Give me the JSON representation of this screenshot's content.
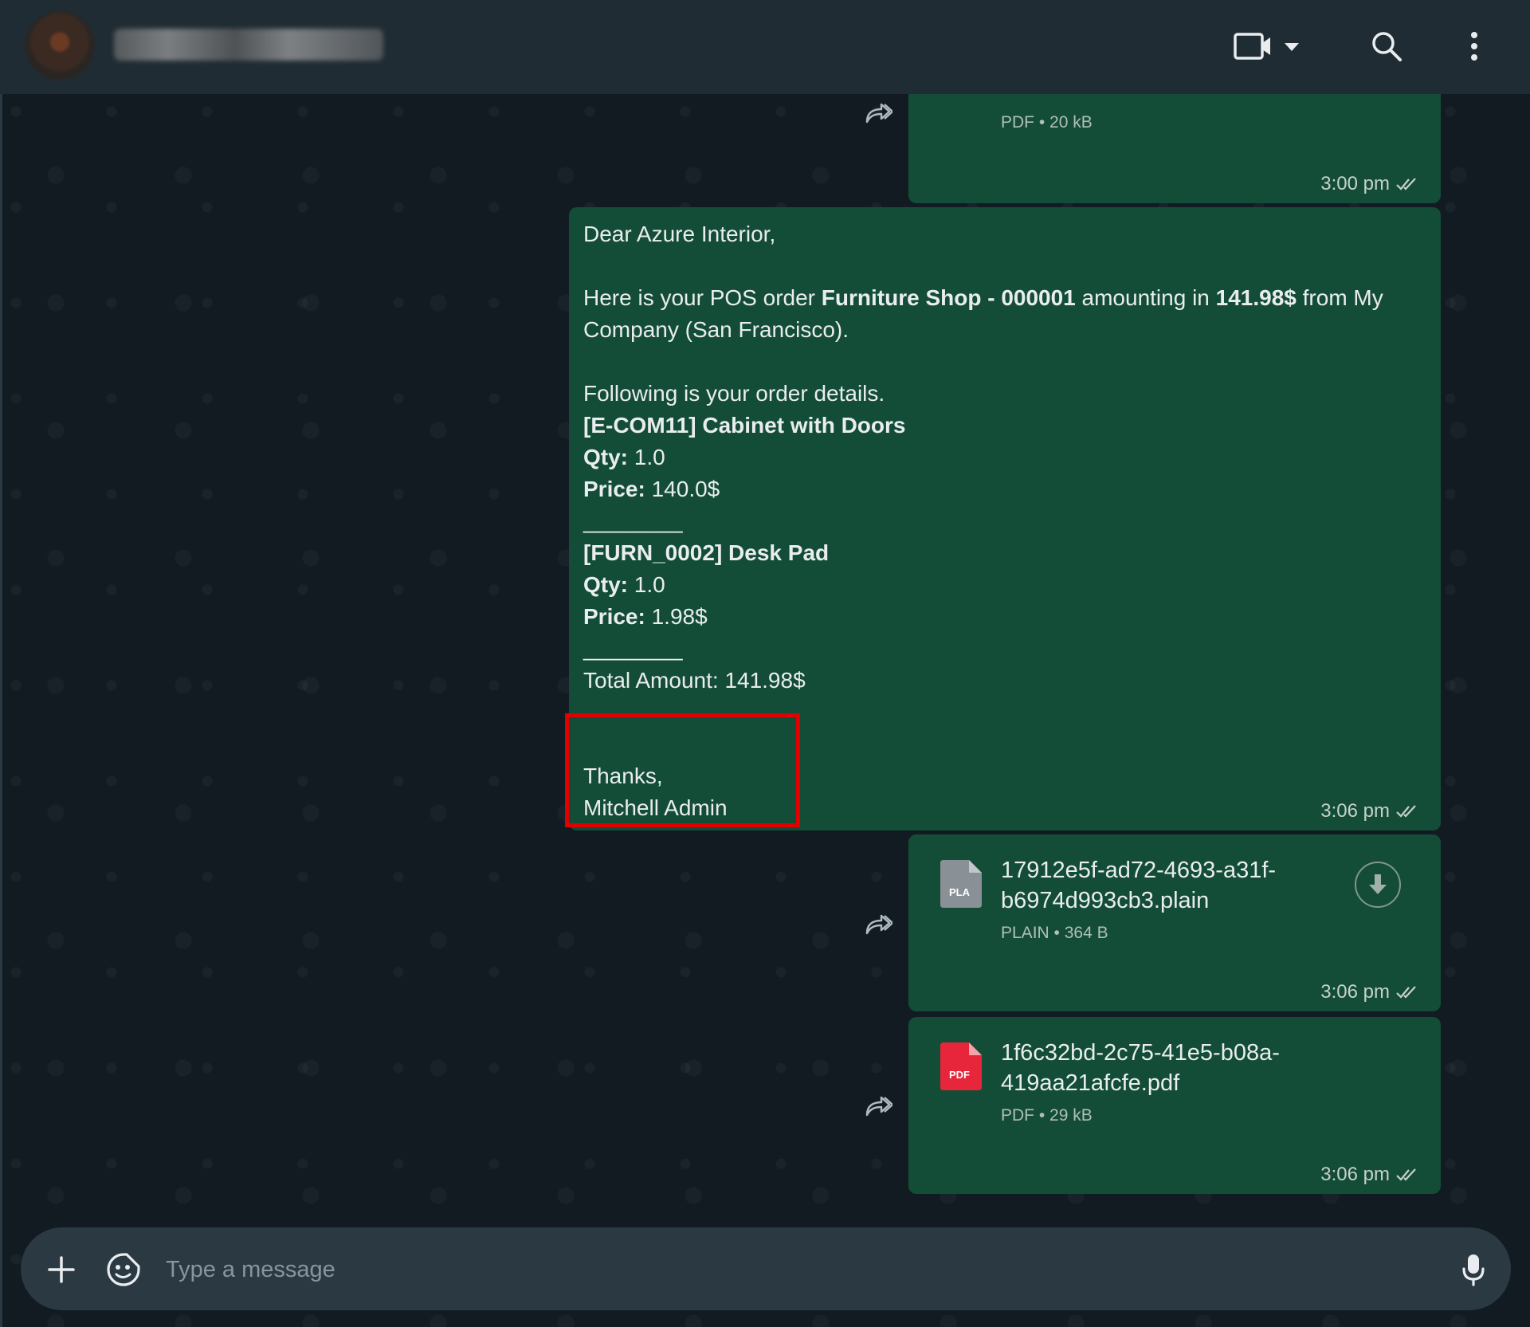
{
  "header": {
    "icons": [
      "video-call-icon",
      "chevron-down-icon",
      "search-icon",
      "more-vert-icon"
    ]
  },
  "messages": {
    "top_file": {
      "meta": "PDF • 20 kB",
      "time": "3:00 pm"
    },
    "text": {
      "greeting": "Dear Azure Interior,",
      "intro_prefix": "Here is your POS order ",
      "order_ref": "Furniture Shop - 000001",
      "intro_mid": " amounting in ",
      "amount": "141.98$",
      "intro_suffix": " from My Company (San Francisco).",
      "details_heading": "Following is your order details.",
      "items": [
        {
          "name": "[E-COM11] Cabinet with Doors",
          "qty_label": "Qty:",
          "qty": " 1.0",
          "price_label": "Price:",
          "price": " 140.0$"
        },
        {
          "name": "[FURN_0002] Desk Pad",
          "qty_label": "Qty:",
          "qty": " 1.0",
          "price_label": "Price:",
          "price": " 1.98$"
        }
      ],
      "separator": "________",
      "total": "Total Amount: 141.98$",
      "thanks": "Thanks,",
      "signature": "Mitchell Admin",
      "time": "3:06 pm"
    },
    "file_plain": {
      "icon_label": "PLA",
      "name_line1": "17912e5f-ad72-4693-a31f-",
      "name_line2": "b6974d993cb3.plain",
      "meta": "PLAIN • 364 B",
      "time": "3:06 pm"
    },
    "file_pdf": {
      "icon_label": "PDF",
      "name_line1": "1f6c32bd-2c75-41e5-b08a-",
      "name_line2": "419aa21afcfe.pdf",
      "meta": "PDF • 29 kB",
      "time": "3:06 pm"
    }
  },
  "composer": {
    "placeholder": "Type a message"
  },
  "colors": {
    "bubble": "#144d37",
    "header": "#202c33",
    "highlight": "#e00000"
  }
}
